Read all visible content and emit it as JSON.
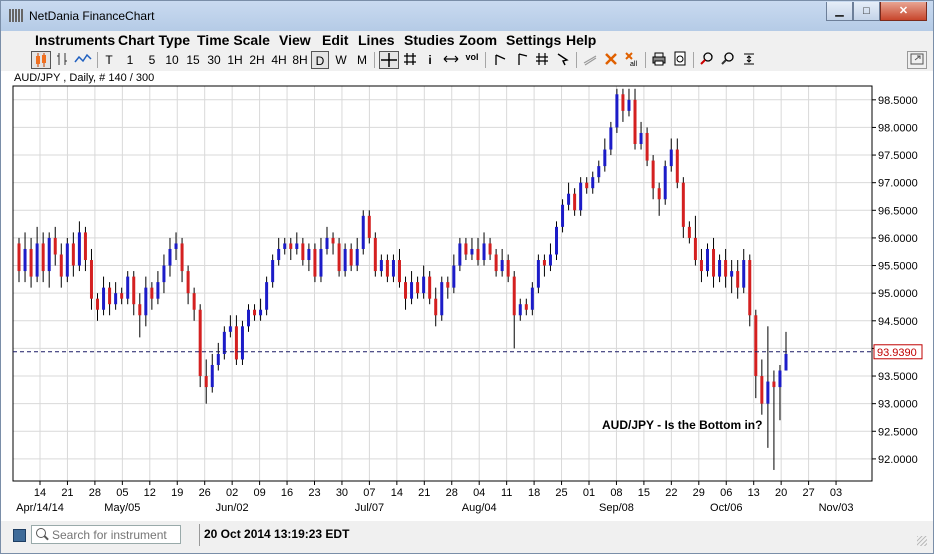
{
  "window": {
    "title": "NetDania FinanceChart",
    "buttons": {
      "minimize": "▁",
      "maximize": "□",
      "close": "✕"
    }
  },
  "menu": [
    "Instruments",
    "Chart Type",
    "Time Scale",
    "View",
    "Edit",
    "Lines",
    "Studies",
    "Zoom",
    "Settings",
    "Help"
  ],
  "toolbar": {
    "chart_types": [
      "candle-icon",
      "bar-icon",
      "line-icon"
    ],
    "timescales": [
      "T",
      "1",
      "5",
      "10",
      "15",
      "30",
      "1H",
      "2H",
      "4H",
      "8H",
      "D",
      "W",
      "M"
    ],
    "selected_timescale": "D",
    "tools": [
      "crosshair-icon",
      "grid-icon",
      "info-icon",
      "scroll-icon",
      "volume-icon",
      "trendline-icon",
      "ray-icon",
      "channel-icon",
      "arrow-icon",
      "pen-icon",
      "delete-icon",
      "delete-all-icon",
      "print-icon",
      "print-preview-icon",
      "zoom-in-icon",
      "zoom-out-icon",
      "zoom-fit-icon",
      "detach-icon"
    ],
    "vol_label": "vol",
    "info_label": "i"
  },
  "chart_subtitle": "AUD/JPY , Daily, # 140 / 300",
  "annotation": "AUD/JPY - Is the Bottom in?",
  "status": {
    "search_placeholder": "Search for instrument",
    "datetime": "20 Oct 2014 13:19:23 EDT"
  },
  "colors": {
    "up": "#1c1cc8",
    "down": "#d42020",
    "grid": "#d9d9d9",
    "current_line": "#1a1a66",
    "price_box": "#c00000"
  },
  "chart_data": {
    "type": "candlestick",
    "symbol": "AUD/JPY",
    "ylim": [
      91.6,
      98.75
    ],
    "yticks": [
      92.0,
      92.5,
      93.0,
      93.5,
      94.0,
      94.5,
      95.0,
      95.5,
      96.0,
      96.5,
      97.0,
      97.5,
      98.0,
      98.5
    ],
    "ytick_labels": [
      "92.0000",
      "92.5000",
      "93.0000",
      "93.5000",
      "94.0000",
      "94.5000",
      "95.0000",
      "95.5000",
      "96.0000",
      "96.5000",
      "97.0000",
      "97.5000",
      "98.0000",
      "98.5000"
    ],
    "current_price": 93.939,
    "current_price_label": "93.9390",
    "x_day_ticks": [
      "14",
      "21",
      "28",
      "05",
      "12",
      "19",
      "26",
      "02",
      "09",
      "16",
      "23",
      "30",
      "07",
      "14",
      "21",
      "28",
      "04",
      "11",
      "18",
      "25",
      "01",
      "08",
      "15",
      "22",
      "29",
      "06",
      "13",
      "20",
      "27",
      "03"
    ],
    "x_month_labels": [
      {
        "label": "Apr/14/14",
        "tick": 0
      },
      {
        "label": "May/05",
        "tick": 3
      },
      {
        "label": "Jun/02",
        "tick": 7
      },
      {
        "label": "Jul/07",
        "tick": 12
      },
      {
        "label": "Aug/04",
        "tick": 16
      },
      {
        "label": "Sep/08",
        "tick": 21
      },
      {
        "label": "Oct/06",
        "tick": 25
      },
      {
        "label": "Nov/03",
        "tick": 29
      }
    ],
    "candles": [
      [
        95.9,
        95.4,
        96.0,
        95.2
      ],
      [
        95.4,
        95.8,
        96.1,
        95.2
      ],
      [
        95.8,
        95.3,
        96.0,
        95.1
      ],
      [
        95.3,
        95.9,
        96.2,
        95.2
      ],
      [
        95.9,
        95.4,
        96.1,
        95.2
      ],
      [
        95.4,
        96.0,
        96.1,
        95.1
      ],
      [
        96.0,
        95.7,
        96.2,
        95.5
      ],
      [
        95.7,
        95.3,
        95.9,
        95.1
      ],
      [
        95.3,
        95.9,
        96.0,
        95.2
      ],
      [
        95.9,
        95.5,
        96.1,
        95.3
      ],
      [
        95.5,
        96.1,
        96.3,
        95.4
      ],
      [
        96.1,
        95.6,
        96.2,
        95.4
      ],
      [
        95.6,
        94.9,
        95.8,
        94.7
      ],
      [
        94.9,
        94.7,
        95.0,
        94.5
      ],
      [
        94.7,
        95.1,
        95.3,
        94.6
      ],
      [
        95.1,
        94.8,
        95.2,
        94.6
      ],
      [
        94.8,
        95.0,
        95.2,
        94.7
      ],
      [
        95.0,
        94.9,
        95.1,
        94.8
      ],
      [
        94.9,
        95.3,
        95.4,
        94.8
      ],
      [
        95.3,
        94.8,
        95.4,
        94.6
      ],
      [
        94.8,
        94.6,
        95.0,
        94.2
      ],
      [
        94.6,
        95.1,
        95.3,
        94.4
      ],
      [
        95.1,
        94.9,
        95.2,
        94.7
      ],
      [
        94.9,
        95.2,
        95.4,
        94.8
      ],
      [
        95.2,
        95.5,
        95.7,
        95.0
      ],
      [
        95.5,
        95.8,
        96.0,
        95.3
      ],
      [
        95.8,
        95.9,
        96.1,
        95.6
      ],
      [
        95.9,
        95.4,
        96.0,
        95.2
      ],
      [
        95.4,
        95.0,
        95.5,
        94.8
      ],
      [
        95.0,
        94.7,
        95.1,
        94.5
      ],
      [
        94.7,
        93.5,
        94.8,
        93.3
      ],
      [
        93.5,
        93.3,
        93.8,
        93.0
      ],
      [
        93.3,
        93.7,
        93.9,
        93.2
      ],
      [
        93.7,
        93.9,
        94.1,
        93.6
      ],
      [
        93.9,
        94.3,
        94.4,
        93.8
      ],
      [
        94.3,
        94.4,
        94.6,
        94.2
      ],
      [
        94.4,
        93.8,
        94.6,
        93.7
      ],
      [
        93.8,
        94.4,
        94.5,
        93.7
      ],
      [
        94.4,
        94.7,
        94.8,
        94.3
      ],
      [
        94.7,
        94.6,
        94.8,
        94.5
      ],
      [
        94.6,
        94.7,
        94.9,
        94.5
      ],
      [
        94.7,
        95.2,
        95.3,
        94.6
      ],
      [
        95.2,
        95.6,
        95.7,
        95.1
      ],
      [
        95.6,
        95.8,
        96.0,
        95.5
      ],
      [
        95.8,
        95.9,
        96.0,
        95.7
      ],
      [
        95.9,
        95.8,
        96.0,
        95.6
      ],
      [
        95.8,
        95.9,
        96.1,
        95.7
      ],
      [
        95.9,
        95.6,
        96.0,
        95.5
      ],
      [
        95.6,
        95.8,
        95.9,
        95.4
      ],
      [
        95.8,
        95.3,
        95.9,
        95.2
      ],
      [
        95.3,
        95.8,
        96.0,
        95.2
      ],
      [
        95.8,
        96.0,
        96.2,
        95.7
      ],
      [
        96.0,
        95.9,
        96.1,
        95.7
      ],
      [
        95.9,
        95.4,
        96.0,
        95.3
      ],
      [
        95.4,
        95.8,
        95.9,
        95.3
      ],
      [
        95.8,
        95.5,
        95.9,
        95.4
      ],
      [
        95.5,
        95.8,
        96.0,
        95.4
      ],
      [
        95.8,
        96.4,
        96.5,
        95.7
      ],
      [
        96.4,
        96.0,
        96.5,
        95.9
      ],
      [
        96.0,
        95.4,
        96.1,
        95.3
      ],
      [
        95.4,
        95.6,
        95.7,
        95.3
      ],
      [
        95.6,
        95.3,
        95.7,
        95.2
      ],
      [
        95.3,
        95.6,
        95.7,
        95.2
      ],
      [
        95.6,
        95.2,
        95.8,
        95.1
      ],
      [
        95.2,
        94.9,
        95.3,
        94.7
      ],
      [
        94.9,
        95.2,
        95.4,
        94.8
      ],
      [
        95.2,
        95.0,
        95.3,
        94.9
      ],
      [
        95.0,
        95.3,
        95.5,
        94.9
      ],
      [
        95.3,
        94.9,
        95.4,
        94.8
      ],
      [
        94.9,
        94.6,
        95.1,
        94.4
      ],
      [
        94.6,
        95.2,
        95.3,
        94.5
      ],
      [
        95.2,
        95.1,
        95.3,
        94.9
      ],
      [
        95.1,
        95.5,
        95.7,
        95.0
      ],
      [
        95.5,
        95.9,
        96.0,
        95.4
      ],
      [
        95.9,
        95.7,
        96.0,
        95.6
      ],
      [
        95.7,
        95.8,
        96.0,
        95.6
      ],
      [
        95.8,
        95.6,
        96.0,
        95.5
      ],
      [
        95.6,
        95.9,
        96.1,
        95.5
      ],
      [
        95.9,
        95.7,
        96.0,
        95.6
      ],
      [
        95.7,
        95.4,
        95.8,
        95.3
      ],
      [
        95.4,
        95.6,
        95.8,
        95.3
      ],
      [
        95.6,
        95.3,
        95.7,
        95.2
      ],
      [
        95.3,
        94.6,
        95.4,
        94.0
      ],
      [
        94.6,
        94.8,
        94.9,
        94.5
      ],
      [
        94.8,
        94.7,
        94.9,
        94.6
      ],
      [
        94.7,
        95.1,
        95.2,
        94.6
      ],
      [
        95.1,
        95.6,
        95.7,
        95.0
      ],
      [
        95.6,
        95.5,
        95.7,
        95.3
      ],
      [
        95.5,
        95.7,
        95.9,
        95.4
      ],
      [
        95.7,
        96.2,
        96.3,
        95.6
      ],
      [
        96.2,
        96.6,
        96.7,
        96.1
      ],
      [
        96.6,
        96.8,
        97.0,
        96.5
      ],
      [
        96.8,
        96.5,
        96.9,
        96.4
      ],
      [
        96.5,
        97.0,
        97.1,
        96.4
      ],
      [
        97.0,
        96.9,
        97.1,
        96.8
      ],
      [
        96.9,
        97.1,
        97.2,
        96.8
      ],
      [
        97.1,
        97.3,
        97.4,
        97.0
      ],
      [
        97.3,
        97.6,
        97.8,
        97.2
      ],
      [
        97.6,
        98.0,
        98.1,
        97.5
      ],
      [
        98.0,
        98.6,
        98.7,
        97.9
      ],
      [
        98.6,
        98.3,
        98.7,
        98.1
      ],
      [
        98.3,
        98.5,
        98.7,
        98.2
      ],
      [
        98.5,
        97.7,
        98.7,
        97.6
      ],
      [
        97.7,
        97.9,
        98.1,
        97.6
      ],
      [
        97.9,
        97.4,
        98.0,
        97.3
      ],
      [
        97.4,
        96.9,
        97.5,
        96.7
      ],
      [
        96.9,
        96.7,
        97.0,
        96.4
      ],
      [
        96.7,
        97.3,
        97.4,
        96.6
      ],
      [
        97.3,
        97.6,
        97.8,
        97.2
      ],
      [
        97.6,
        97.0,
        97.8,
        96.9
      ],
      [
        97.0,
        96.2,
        97.1,
        96.0
      ],
      [
        96.2,
        96.0,
        96.3,
        95.9
      ],
      [
        96.0,
        95.6,
        96.4,
        95.5
      ],
      [
        95.6,
        95.4,
        95.8,
        95.2
      ],
      [
        95.4,
        95.8,
        95.9,
        95.3
      ],
      [
        95.8,
        95.3,
        96.0,
        95.1
      ],
      [
        95.3,
        95.6,
        95.7,
        95.2
      ],
      [
        95.6,
        95.3,
        95.8,
        95.1
      ],
      [
        95.3,
        95.4,
        95.6,
        95.0
      ],
      [
        95.4,
        95.1,
        95.6,
        94.9
      ],
      [
        95.1,
        95.6,
        95.8,
        95.0
      ],
      [
        95.6,
        94.6,
        95.7,
        94.4
      ],
      [
        94.6,
        93.5,
        94.7,
        93.1
      ],
      [
        93.5,
        93.0,
        93.8,
        92.8
      ],
      [
        93.0,
        93.4,
        94.4,
        92.2
      ],
      [
        93.4,
        93.3,
        93.6,
        91.8
      ],
      [
        93.3,
        93.6,
        93.7,
        92.7
      ],
      [
        93.6,
        93.9,
        94.3,
        93.6
      ]
    ]
  }
}
